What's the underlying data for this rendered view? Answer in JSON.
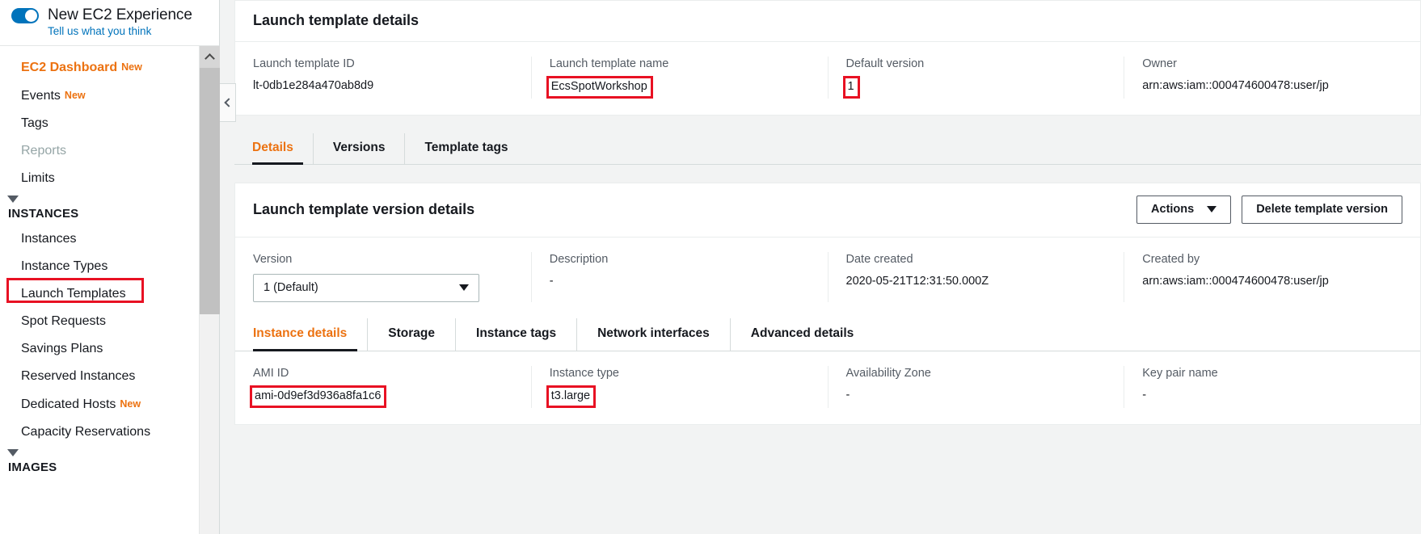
{
  "sidebar": {
    "new_experience_label": "New EC2 Experience",
    "feedback_link": "Tell us what you think",
    "items": [
      {
        "label": "EC2 Dashboard",
        "badge": "New"
      },
      {
        "label": "Events",
        "badge": "New"
      },
      {
        "label": "Tags",
        "badge": ""
      },
      {
        "label": "Reports",
        "badge": ""
      },
      {
        "label": "Limits",
        "badge": ""
      }
    ],
    "sections": [
      {
        "title": "INSTANCES",
        "items": [
          {
            "label": "Instances",
            "badge": ""
          },
          {
            "label": "Instance Types",
            "badge": ""
          },
          {
            "label": "Launch Templates",
            "badge": ""
          },
          {
            "label": "Spot Requests",
            "badge": ""
          },
          {
            "label": "Savings Plans",
            "badge": ""
          },
          {
            "label": "Reserved Instances",
            "badge": ""
          },
          {
            "label": "Dedicated Hosts",
            "badge": "New"
          },
          {
            "label": "Capacity Reservations",
            "badge": ""
          }
        ]
      },
      {
        "title": "IMAGES",
        "items": []
      }
    ]
  },
  "template_details": {
    "title": "Launch template details",
    "fields": [
      {
        "label": "Launch template ID",
        "value": "lt-0db1e284a470ab8d9"
      },
      {
        "label": "Launch template name",
        "value": "EcsSpotWorkshop"
      },
      {
        "label": "Default version",
        "value": "1"
      },
      {
        "label": "Owner",
        "value": "arn:aws:iam::000474600478:user/jp"
      }
    ]
  },
  "top_tabs": [
    {
      "label": "Details"
    },
    {
      "label": "Versions"
    },
    {
      "label": "Template tags"
    }
  ],
  "version_details": {
    "title": "Launch template version details",
    "actions_button": "Actions",
    "delete_button": "Delete template version",
    "fields": [
      {
        "label": "Version",
        "value": "1 (Default)"
      },
      {
        "label": "Description",
        "value": "-"
      },
      {
        "label": "Date created",
        "value": "2020-05-21T12:31:50.000Z"
      },
      {
        "label": "Created by",
        "value": "arn:aws:iam::000474600478:user/jp"
      }
    ]
  },
  "detail_tabs": [
    {
      "label": "Instance details"
    },
    {
      "label": "Storage"
    },
    {
      "label": "Instance tags"
    },
    {
      "label": "Network interfaces"
    },
    {
      "label": "Advanced details"
    }
  ],
  "instance_details": {
    "fields": [
      {
        "label": "AMI ID",
        "value": "ami-0d9ef3d936a8fa1c6"
      },
      {
        "label": "Instance type",
        "value": "t3.large"
      },
      {
        "label": "Availability Zone",
        "value": "-"
      },
      {
        "label": "Key pair name",
        "value": "-"
      }
    ]
  },
  "colors": {
    "accent": "#ec7211",
    "link": "#0073bb",
    "highlight": "#e81123",
    "text": "#16191f"
  }
}
